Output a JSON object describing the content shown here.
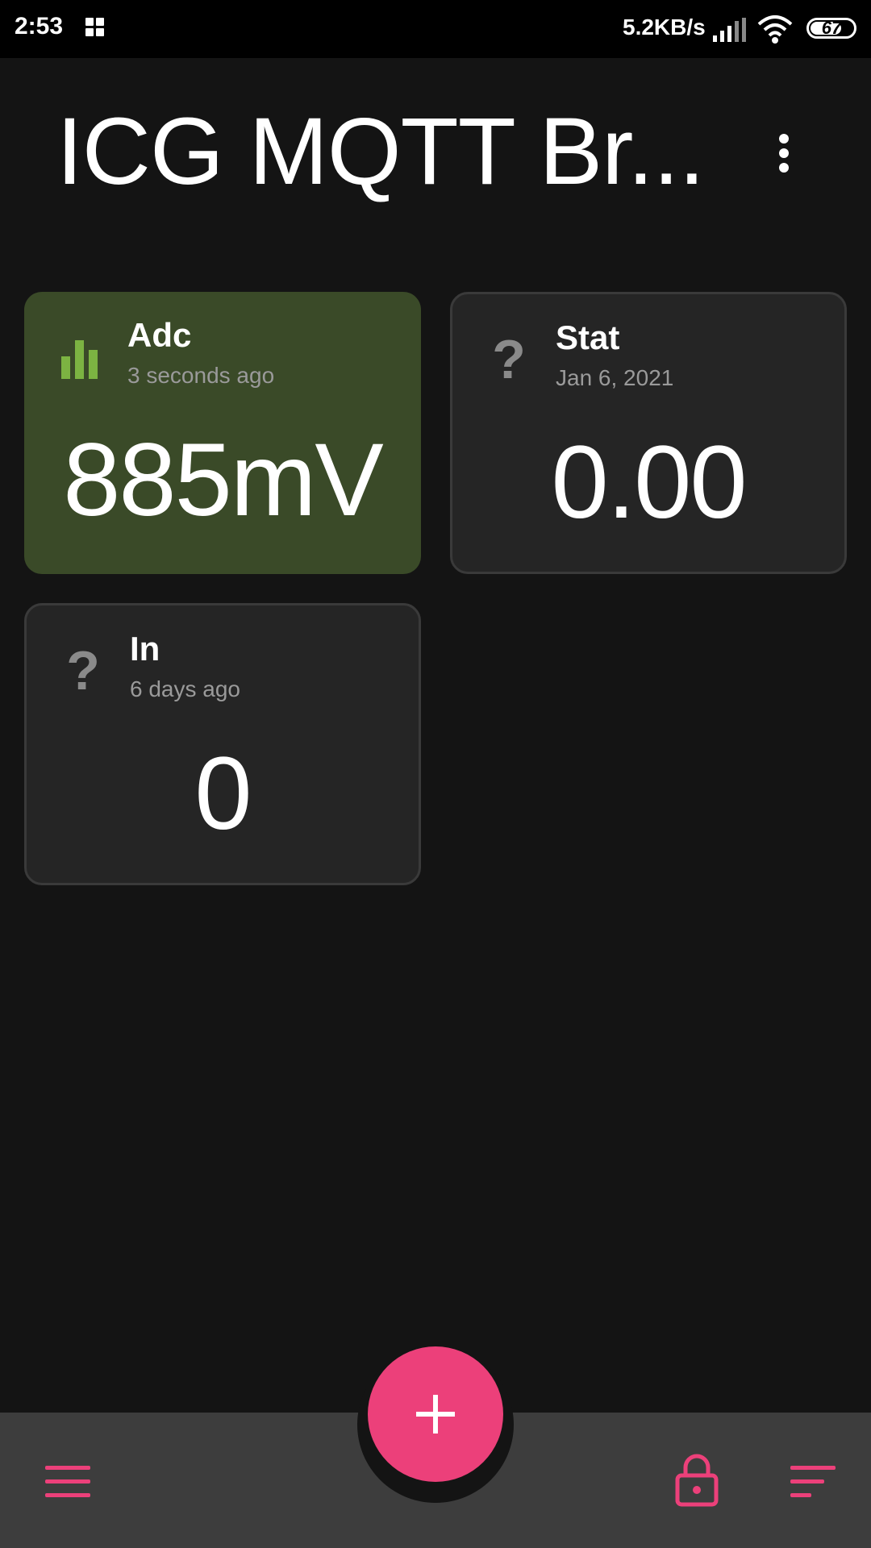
{
  "status_bar": {
    "time": "2:53",
    "net_speed": "5.2KB/s",
    "battery": "67",
    "icons": [
      "apps-grid-icon",
      "signal-icon",
      "wifi-icon",
      "battery-icon"
    ]
  },
  "header": {
    "title": "ICG MQTT Br...",
    "menu_icon": "more-vert-icon"
  },
  "tiles": [
    {
      "name": "Adc",
      "time": "3 seconds ago",
      "value": "885mV",
      "icon": "bar-chart-icon",
      "active": true
    },
    {
      "name": "Stat",
      "time": "Jan 6, 2021",
      "value": "0.00",
      "icon": "question-icon",
      "active": false,
      "glyph": "?"
    },
    {
      "name": "In",
      "time": "6 days ago",
      "value": "0",
      "icon": "question-icon",
      "active": false,
      "glyph": "?"
    }
  ],
  "bottom_bar": {
    "left_icon": "menu-icon",
    "fab_icon": "plus-icon",
    "lock_icon": "lock-icon",
    "sort_icon": "sort-icon"
  },
  "colors": {
    "background": "#141414",
    "active_tile": "#3a4a28",
    "accent": "#ec407a",
    "chart_icon": "#7cb342"
  }
}
